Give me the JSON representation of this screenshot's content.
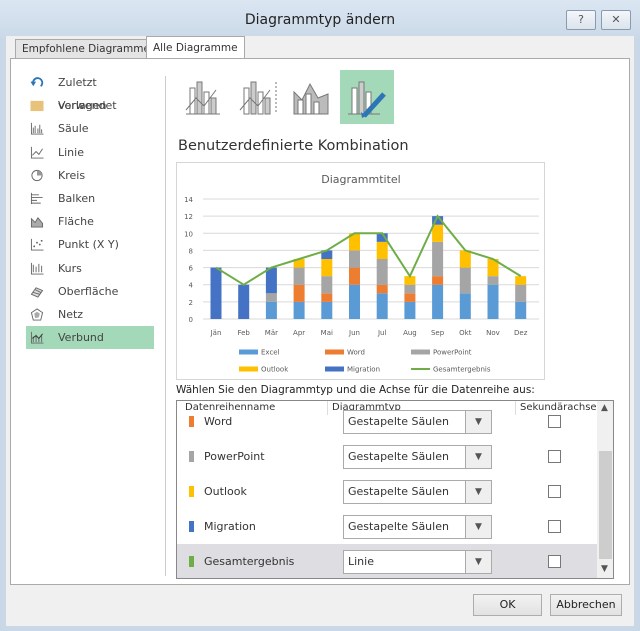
{
  "window": {
    "title": "Diagrammtyp ändern",
    "help": "?",
    "close": "✕"
  },
  "tabs": [
    "Empfohlene Diagramme",
    "Alle Diagramme"
  ],
  "sidebar": [
    {
      "label": "Zuletzt verwendet",
      "icon": "recent-icon"
    },
    {
      "label": "Vorlagen",
      "icon": "folder-icon"
    },
    {
      "label": "Säule",
      "icon": "column-chart-icon"
    },
    {
      "label": "Linie",
      "icon": "line-chart-icon"
    },
    {
      "label": "Kreis",
      "icon": "pie-chart-icon"
    },
    {
      "label": "Balken",
      "icon": "bar-chart-icon"
    },
    {
      "label": "Fläche",
      "icon": "area-chart-icon"
    },
    {
      "label": "Punkt (X Y)",
      "icon": "scatter-chart-icon"
    },
    {
      "label": "Kurs",
      "icon": "stock-chart-icon"
    },
    {
      "label": "Oberfläche",
      "icon": "surface-chart-icon"
    },
    {
      "label": "Netz",
      "icon": "radar-chart-icon"
    },
    {
      "label": "Verbund",
      "icon": "combo-chart-icon",
      "selected": true
    }
  ],
  "subtype_heading": "Benutzerdefinierte Kombination",
  "series_prompt": "Wählen Sie den Diagrammtyp und die Achse für die Datenreihe aus:",
  "table": {
    "headers": [
      "Datenreihenname",
      "Diagrammtyp",
      "Sekundärachse"
    ],
    "rows": [
      {
        "name": "Word",
        "type": "Gestapelte Säulen",
        "color": "#ed7d31",
        "secondary": false
      },
      {
        "name": "PowerPoint",
        "type": "Gestapelte Säulen",
        "color": "#a5a5a5",
        "secondary": false
      },
      {
        "name": "Outlook",
        "type": "Gestapelte Säulen",
        "color": "#ffc000",
        "secondary": false
      },
      {
        "name": "Migration",
        "type": "Gestapelte Säulen",
        "color": "#4472c4",
        "secondary": false
      },
      {
        "name": "Gesamtergebnis",
        "type": "Linie",
        "color": "#70ad47",
        "secondary": false
      }
    ]
  },
  "buttons": {
    "ok": "OK",
    "cancel": "Abbrechen"
  },
  "chart_data": {
    "type": "bar",
    "title": "Diagrammtitel",
    "categories": [
      "Jän",
      "Feb",
      "Mär",
      "Apr",
      "Mai",
      "Jun",
      "Jul",
      "Aug",
      "Sep",
      "Okt",
      "Nov",
      "Dez"
    ],
    "ylim": [
      0,
      14
    ],
    "yticks": [
      0,
      2,
      4,
      6,
      8,
      10,
      12,
      14
    ],
    "legend_position": "bottom",
    "series": [
      {
        "name": "Excel",
        "color": "#5b9bd5",
        "kind": "stacked",
        "values": [
          0,
          0,
          2,
          2,
          2,
          4,
          3,
          2,
          4,
          3,
          4,
          2
        ]
      },
      {
        "name": "Word",
        "color": "#ed7d31",
        "kind": "stacked",
        "values": [
          0,
          0,
          0,
          2,
          1,
          2,
          1,
          1,
          1,
          0,
          0,
          0
        ]
      },
      {
        "name": "PowerPoint",
        "color": "#a5a5a5",
        "kind": "stacked",
        "values": [
          0,
          0,
          1,
          2,
          2,
          2,
          3,
          1,
          4,
          3,
          1,
          2
        ]
      },
      {
        "name": "Outlook",
        "color": "#ffc000",
        "kind": "stacked",
        "values": [
          0,
          0,
          0,
          1,
          2,
          2,
          2,
          1,
          2,
          2,
          2,
          1
        ]
      },
      {
        "name": "Migration",
        "color": "#4472c4",
        "kind": "stacked",
        "values": [
          6,
          4,
          3,
          0,
          1,
          0,
          1,
          0,
          1,
          0,
          0,
          0
        ]
      },
      {
        "name": "Gesamtergebnis",
        "color": "#70ad47",
        "kind": "line",
        "values": [
          6,
          4,
          6,
          7,
          8,
          10,
          10,
          5,
          12,
          8,
          7,
          5
        ]
      }
    ]
  }
}
